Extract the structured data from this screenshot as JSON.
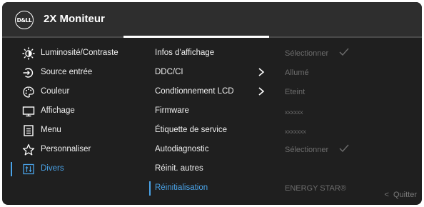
{
  "header": {
    "logo_text": "D&LL",
    "title": "2X Moniteur"
  },
  "menu": {
    "items": [
      {
        "label": "Luminosité/Contraste",
        "icon": "brightness-icon"
      },
      {
        "label": "Source entrée",
        "icon": "input-source-icon"
      },
      {
        "label": "Couleur",
        "icon": "palette-icon"
      },
      {
        "label": "Affichage",
        "icon": "display-icon"
      },
      {
        "label": "Menu",
        "icon": "menu-icon"
      },
      {
        "label": "Personnaliser",
        "icon": "star-icon"
      },
      {
        "label": "Divers",
        "icon": "misc-icon",
        "active": true
      }
    ]
  },
  "submenu": {
    "items": [
      {
        "label": "Infos d'affichage",
        "value": "Sélectionner",
        "value_icon": "check-icon"
      },
      {
        "label": "DDC/CI",
        "value": "Allumé",
        "arrow": true
      },
      {
        "label": "Condtionnement LCD",
        "value": "Eteint",
        "arrow": true
      },
      {
        "label": "Firmware",
        "value": "xxxxxx"
      },
      {
        "label": "Étiquette de service",
        "value": "xxxxxxx"
      },
      {
        "label": "Autodiagnostic",
        "value": "Sélectionner",
        "value_icon": "check-icon"
      },
      {
        "label": "Réinit. autres",
        "value": ""
      },
      {
        "label": "Réinitialisation",
        "value": "ENERGY STAR®",
        "active": true
      }
    ]
  },
  "footer": {
    "quit_label": "Quitter",
    "quit_icon": "chevron-left-icon"
  },
  "colors": {
    "accent": "#4aa3e8",
    "background": "#1f1f1f",
    "header": "#2e2e2e",
    "muted_text": "#6d6d6d"
  }
}
